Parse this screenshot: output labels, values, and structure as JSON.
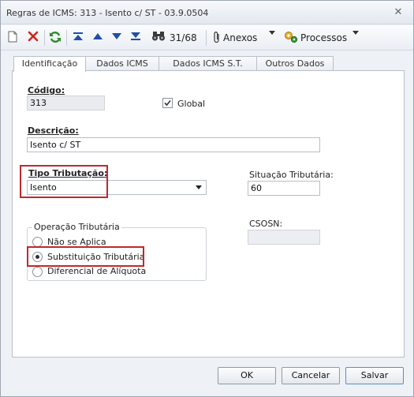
{
  "window": {
    "title": "Regras de ICMS: 313 - Isento c/ ST - 03.9.0504",
    "close_glyph": "✕"
  },
  "toolbar": {
    "record_counter": "31/68",
    "anexos_label": "Anexos",
    "processos_label": "Processos",
    "icons": [
      "new-document-icon",
      "delete-icon",
      "refresh-icon",
      "first-record-icon",
      "previous-record-icon",
      "next-record-icon",
      "last-record-icon",
      "search-binoculars-icon",
      "paperclip-icon",
      "processes-icon"
    ]
  },
  "tabs": [
    {
      "label": "Identificação",
      "active": true
    },
    {
      "label": "Dados ICMS",
      "active": false
    },
    {
      "label": "Dados ICMS S.T.",
      "active": false
    },
    {
      "label": "Outros Dados",
      "active": false
    }
  ],
  "form": {
    "codigo_label": "Código:",
    "codigo_value": "313",
    "global_label": "Global",
    "global_checked": true,
    "descricao_label": "Descrição:",
    "descricao_value": "Isento c/ ST",
    "tipo_tributacao_label": "Tipo Tributação:",
    "tipo_tributacao_value": "Isento",
    "situacao_label": "Situação Tributária:",
    "situacao_value": "60",
    "csosn_label": "CSOSN:",
    "csosn_value": "",
    "operacao_title": "Operação Tributária",
    "operacao_options": [
      "Não se Aplica",
      "Substituição Tributária",
      "Diferencial de Alíquota"
    ],
    "operacao_selected": "Substituição Tributária"
  },
  "buttons": {
    "ok": "OK",
    "cancel": "Cancelar",
    "save": "Salvar"
  },
  "colors": {
    "highlight": "#c1272d",
    "accent": "#5c8fc9"
  }
}
